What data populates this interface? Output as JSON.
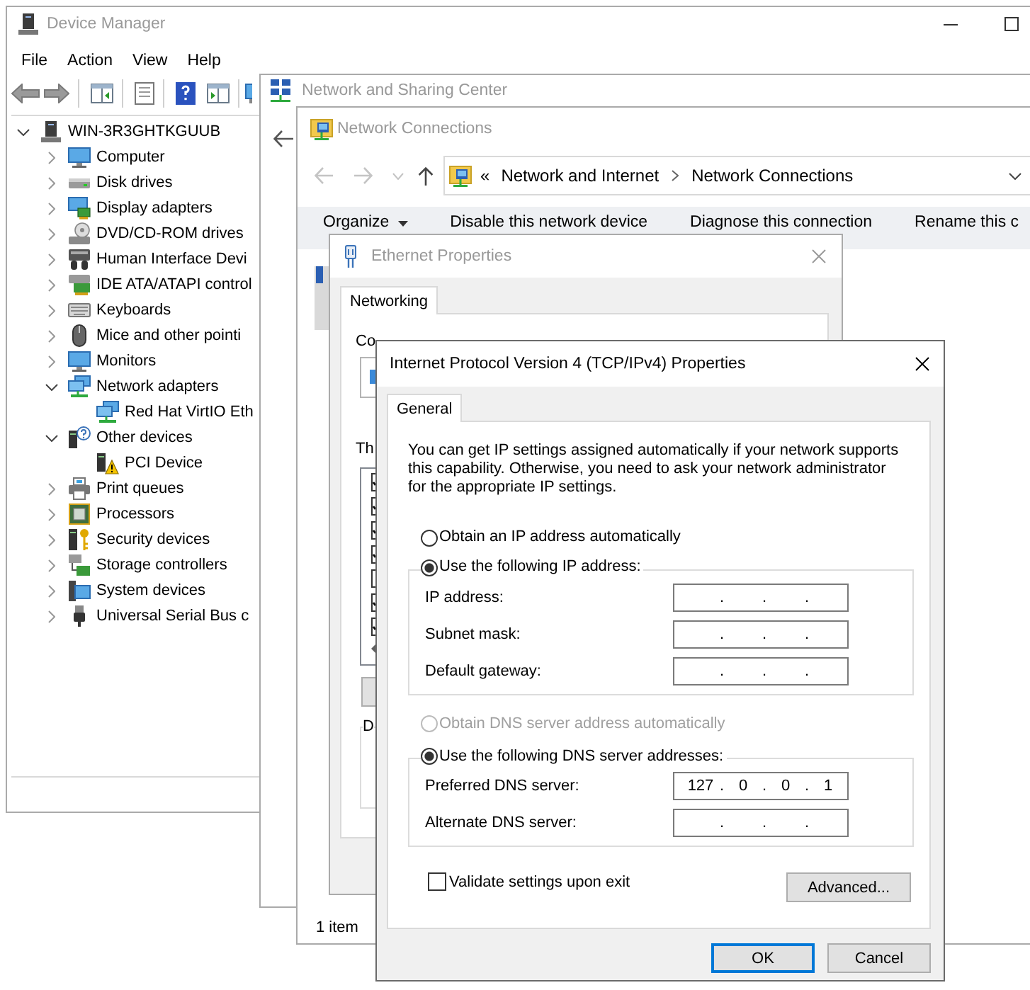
{
  "device_manager": {
    "title": "Device Manager",
    "active": false,
    "menu": [
      "File",
      "Action",
      "View",
      "Help"
    ],
    "tree": {
      "label": "WIN-3R3GHTKGUUB",
      "kind": "host",
      "expanded": true,
      "children": [
        {
          "label": "Computer",
          "kind": "computer",
          "expanded": false
        },
        {
          "label": "Disk drives",
          "kind": "disk",
          "expanded": false
        },
        {
          "label": "Display adapters",
          "kind": "display",
          "expanded": false
        },
        {
          "label": "DVD/CD-ROM drives",
          "kind": "optical",
          "expanded": false
        },
        {
          "label": "Human Interface Devi",
          "kind": "hid",
          "expanded": false
        },
        {
          "label": "IDE ATA/ATAPI control",
          "kind": "controller",
          "expanded": false
        },
        {
          "label": "Keyboards",
          "kind": "keyboard",
          "expanded": false
        },
        {
          "label": "Mice and other pointi",
          "kind": "mouse",
          "expanded": false
        },
        {
          "label": "Monitors",
          "kind": "monitor",
          "expanded": false
        },
        {
          "label": "Network adapters",
          "kind": "network",
          "expanded": true,
          "children": [
            {
              "label": "Red Hat VirtIO Eth",
              "kind": "network"
            }
          ]
        },
        {
          "label": "Other devices",
          "kind": "unknown",
          "expanded": true,
          "children": [
            {
              "label": "PCI Device",
              "kind": "warning"
            }
          ]
        },
        {
          "label": "Print queues",
          "kind": "printer",
          "expanded": false
        },
        {
          "label": "Processors",
          "kind": "processor",
          "expanded": false
        },
        {
          "label": "Security devices",
          "kind": "security",
          "expanded": false
        },
        {
          "label": "Storage controllers",
          "kind": "storage",
          "expanded": false
        },
        {
          "label": "System devices",
          "kind": "system",
          "expanded": false
        },
        {
          "label": "Universal Serial Bus c",
          "kind": "usb",
          "expanded": false
        }
      ]
    }
  },
  "network_sharing_center": {
    "title": "Network and Sharing Center",
    "active": false
  },
  "network_connections": {
    "title": "Network Connections",
    "active": false,
    "address": {
      "overflow": "«",
      "path": [
        "Network and Internet",
        "Network Connections"
      ]
    },
    "commands": [
      {
        "label": "Organize",
        "kind": "menu"
      },
      {
        "label": "Disable this network device",
        "kind": "action"
      },
      {
        "label": "Diagnose this connection",
        "kind": "action"
      },
      {
        "label": "Rename this c",
        "kind": "action"
      }
    ],
    "connection_item": {
      "selected": true
    },
    "status_bar": "1 item"
  },
  "ethernet_properties": {
    "title": "Ethernet Properties",
    "active": false,
    "tabs": [
      {
        "label": "Networking",
        "selected": true
      }
    ],
    "connect_using_label": "Co",
    "items_label": "Th",
    "items": [
      {
        "checked": true
      },
      {
        "checked": true
      },
      {
        "checked": true
      },
      {
        "checked": true
      },
      {
        "checked": false
      },
      {
        "checked": true
      },
      {
        "checked": true
      }
    ],
    "description_label": "D"
  },
  "ipv4_properties": {
    "title": "Internet Protocol Version 4 (TCP/IPv4) Properties",
    "active": true,
    "tabs": [
      {
        "label": "General",
        "selected": true
      }
    ],
    "description": "You can get IP settings assigned automatically if your network supports this capability. Otherwise, you need to ask your network administrator for the appropriate IP settings.",
    "ip_options": [
      {
        "label": "Obtain an IP address automatically",
        "selected": false,
        "disabled": false
      },
      {
        "label": "Use the following IP address:",
        "selected": true,
        "disabled": false,
        "fields": [
          {
            "label": "IP address:",
            "separators": [
              ".",
              ".",
              "."
            ]
          },
          {
            "label": "Subnet mask:",
            "separators": [
              ".",
              ".",
              "."
            ]
          },
          {
            "label": "Default gateway:",
            "separators": [
              ".",
              ".",
              "."
            ]
          }
        ]
      }
    ],
    "dns_options": [
      {
        "label": "Obtain DNS server address automatically",
        "selected": false,
        "disabled": true
      },
      {
        "label": "Use the following DNS server addresses:",
        "selected": true,
        "disabled": false,
        "fields": [
          {
            "label": "Preferred DNS server:",
            "octets": [
              "127",
              "0",
              "0",
              "1"
            ],
            "separators": [
              ".",
              ".",
              "."
            ]
          },
          {
            "label": "Alternate DNS server:",
            "separators": [
              ".",
              ".",
              "."
            ]
          }
        ]
      }
    ],
    "validate": {
      "label": "Validate settings upon exit",
      "checked": false
    },
    "advanced_button": "Advanced...",
    "buttons": [
      {
        "label": "OK",
        "default": true
      },
      {
        "label": "Cancel",
        "default": false
      }
    ]
  }
}
